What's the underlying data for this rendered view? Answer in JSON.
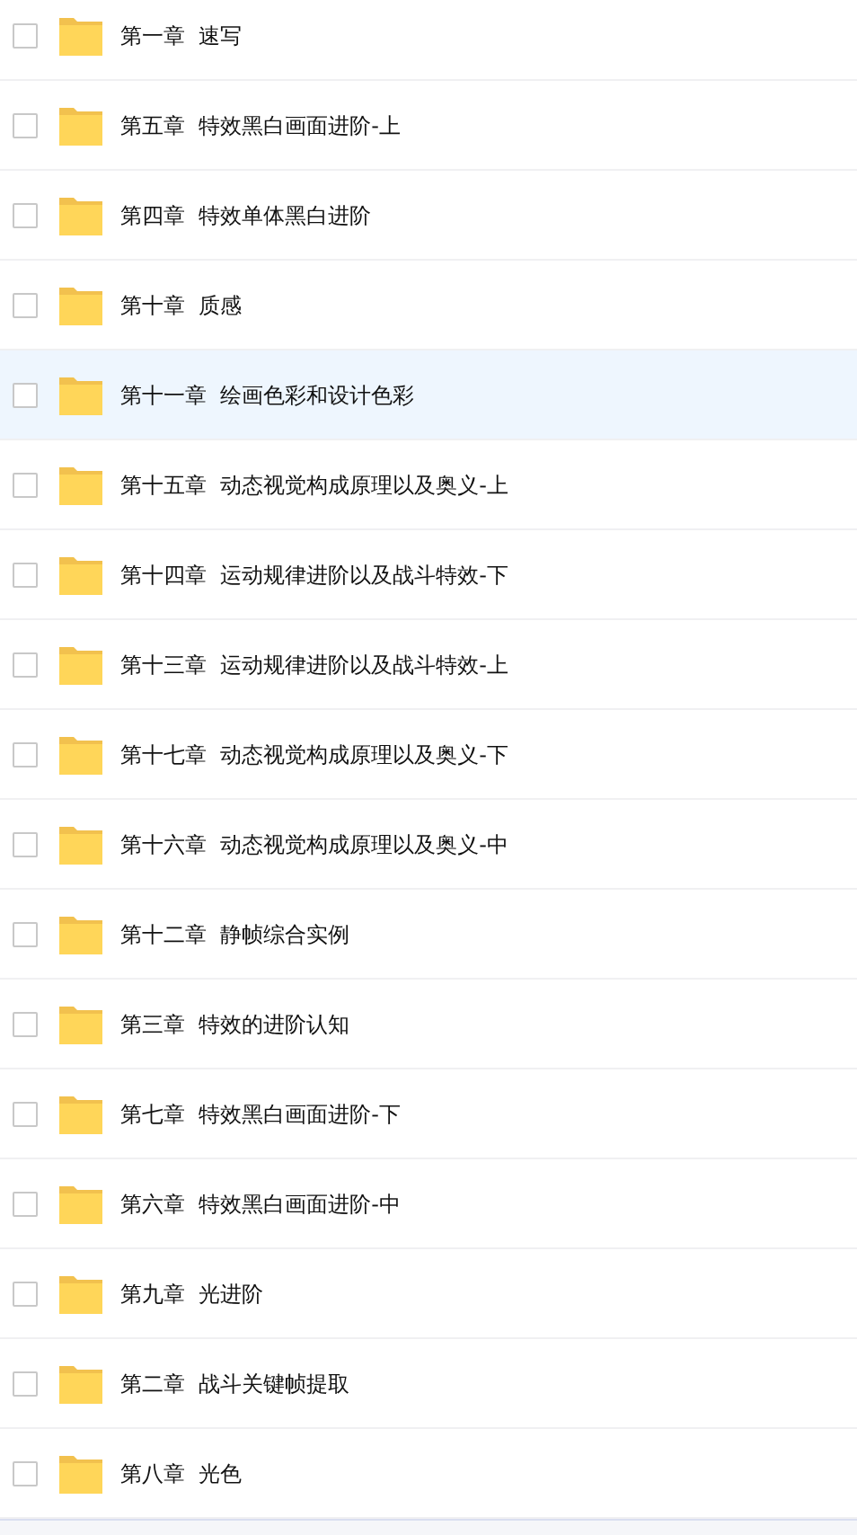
{
  "files": [
    {
      "name": "第一章  速写",
      "checked": false,
      "highlighted": false
    },
    {
      "name": "第五章  特效黑白画面进阶-上",
      "checked": false,
      "highlighted": false
    },
    {
      "name": "第四章  特效单体黑白进阶",
      "checked": false,
      "highlighted": false
    },
    {
      "name": "第十章  质感",
      "checked": false,
      "highlighted": false
    },
    {
      "name": "第十一章  绘画色彩和设计色彩",
      "checked": false,
      "highlighted": true
    },
    {
      "name": "第十五章  动态视觉构成原理以及奥义-上",
      "checked": false,
      "highlighted": false
    },
    {
      "name": "第十四章  运动规律进阶以及战斗特效-下",
      "checked": false,
      "highlighted": false
    },
    {
      "name": "第十三章  运动规律进阶以及战斗特效-上",
      "checked": false,
      "highlighted": false
    },
    {
      "name": "第十七章  动态视觉构成原理以及奥义-下",
      "checked": false,
      "highlighted": false
    },
    {
      "name": "第十六章  动态视觉构成原理以及奥义-中",
      "checked": false,
      "highlighted": false
    },
    {
      "name": "第十二章  静帧综合实例",
      "checked": false,
      "highlighted": false
    },
    {
      "name": "第三章  特效的进阶认知",
      "checked": false,
      "highlighted": false
    },
    {
      "name": "第七章  特效黑白画面进阶-下",
      "checked": false,
      "highlighted": false
    },
    {
      "name": "第六章  特效黑白画面进阶-中",
      "checked": false,
      "highlighted": false
    },
    {
      "name": "第九章  光进阶",
      "checked": false,
      "highlighted": false
    },
    {
      "name": "第二章  战斗关键帧提取",
      "checked": false,
      "highlighted": false
    },
    {
      "name": "第八章  光色",
      "checked": false,
      "highlighted": false
    }
  ]
}
